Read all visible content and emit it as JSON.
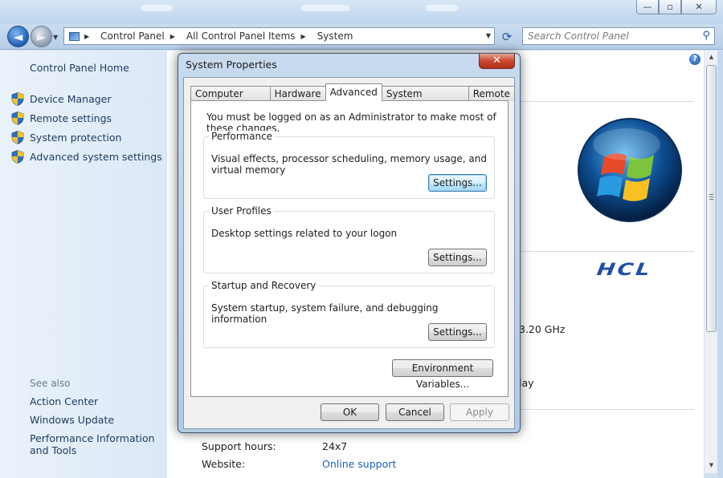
{
  "window": {
    "minimize_icon": "minimize-icon",
    "maximize_icon": "maximize-icon",
    "close_icon": "close-icon",
    "minimize_glyph": "—",
    "restore_glyph": "▫",
    "close_glyph": "✕"
  },
  "nav": {
    "back_glyph": "◄",
    "forward_glyph": "►",
    "dropdown_glyph": "▼",
    "breadcrumbs": [
      "Control Panel",
      "All Control Panel Items",
      "System"
    ],
    "crumb_separator": "▶",
    "refresh_glyph": "⟳",
    "search_placeholder": "Search Control Panel",
    "search_glyph": "⚲"
  },
  "sidebar": {
    "home": "Control Panel Home",
    "items": [
      {
        "label": "Device Manager"
      },
      {
        "label": "Remote settings"
      },
      {
        "label": "System protection"
      },
      {
        "label": "Advanced system settings"
      }
    ],
    "see_also": "See also",
    "links": [
      {
        "label": "Action Center"
      },
      {
        "label": "Windows Update"
      },
      {
        "label": "Performance Information and Tools"
      }
    ]
  },
  "main": {
    "help_glyph": "?",
    "brand": "HCL",
    "processor_fragment": "3.20 GHz",
    "display_fragment": "lay",
    "support_rows": [
      {
        "label": "Support hours:",
        "value": "24x7"
      },
      {
        "label": "Website:",
        "value": "Online support"
      }
    ]
  },
  "dialog": {
    "title": "System Properties",
    "close_glyph": "✕",
    "tabs": [
      {
        "label": "Computer Name",
        "active": false
      },
      {
        "label": "Hardware",
        "active": false
      },
      {
        "label": "Advanced",
        "active": true
      },
      {
        "label": "System Protection",
        "active": false
      },
      {
        "label": "Remote",
        "active": false
      }
    ],
    "admin_note": "You must be logged on as an Administrator to make most of these changes.",
    "groups": [
      {
        "label": "Performance",
        "description": "Visual effects, processor scheduling, memory usage, and virtual memory",
        "button": "Settings..."
      },
      {
        "label": "User Profiles",
        "description": "Desktop settings related to your logon",
        "button": "Settings..."
      },
      {
        "label": "Startup and Recovery",
        "description": "System startup, system failure, and debugging information",
        "button": "Settings..."
      }
    ],
    "env_button": "Environment Variables...",
    "ok": "OK",
    "cancel": "Cancel",
    "apply": "Apply"
  }
}
